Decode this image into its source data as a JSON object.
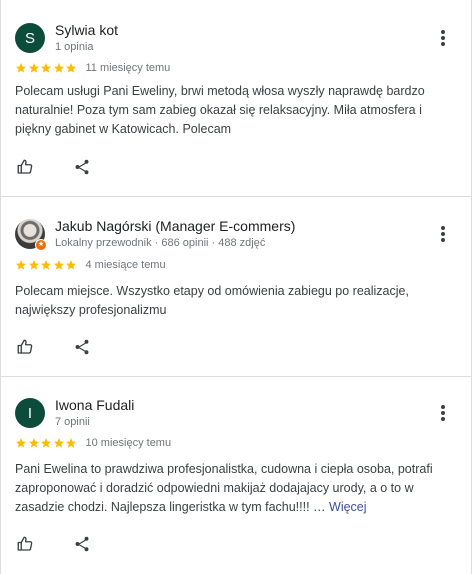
{
  "reviews": [
    {
      "avatar_letter": "S",
      "name": "Sylwia kot",
      "meta": "1 opinia",
      "rating": 5,
      "ago": "11 miesięcy temu",
      "text": "Polecam usługi Pani Eweliny, brwi metodą włosa wyszły naprawdę bardzo naturalnie! Poza tym sam zabieg okazał się relaksacyjny. Miła atmosfera i piękny gabinet w Katowicach. Polecam"
    },
    {
      "avatar_letter": "",
      "name": "Jakub Nagórski (Manager E-commers)",
      "meta": "Lokalny przewodnik · 686 opinii · 488 zdjęć",
      "rating": 5,
      "ago": "4 miesiące temu",
      "text": "Polecam miejsce. Wszystko etapy od omówienia zabiegu po realizacje, największy profesjonalizmu"
    },
    {
      "avatar_letter": "I",
      "name": "Iwona Fudali",
      "meta": "7 opinii",
      "rating": 5,
      "ago": "10 miesięcy temu",
      "text": "Pani Ewelina to prawdziwa profesjonalistka, cudowna i ciepła osoba, potrafi zaproponować i doradzić odpowiedni makijaż dodajajacy urody, a o to w zasadzie chodzi. Najlepsza lingeristka w tym fachu!!!! …",
      "more_label": "Więcej"
    }
  ],
  "colors": {
    "star": "#fbbc04",
    "avatar_green": "#0b4d3a",
    "link": "#3c4f9e"
  }
}
